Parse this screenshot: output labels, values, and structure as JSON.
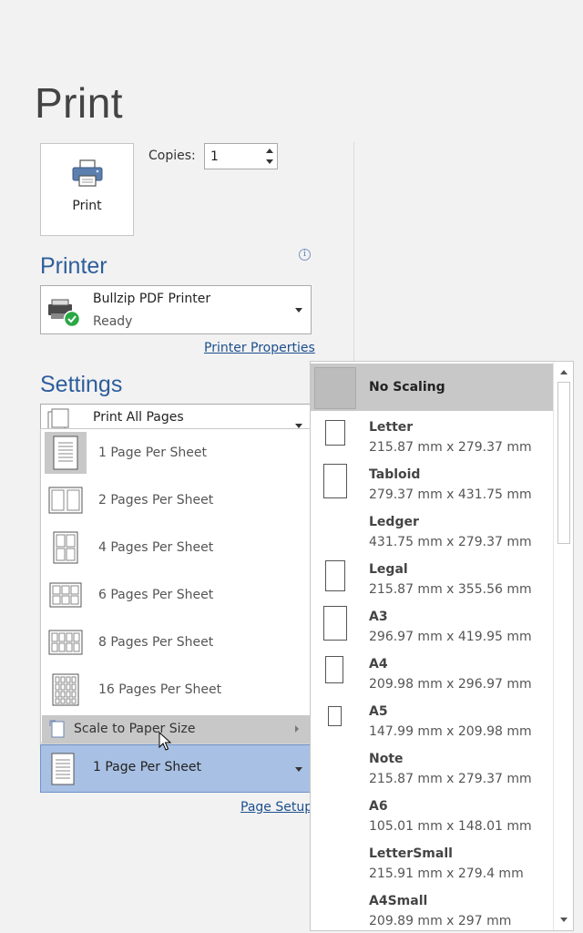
{
  "title": "Print",
  "print_button": {
    "label": "Print",
    "icon": "printer-icon"
  },
  "copies": {
    "label": "Copies:",
    "value": "1"
  },
  "printer": {
    "heading": "Printer",
    "name": "Bullzip PDF Printer",
    "status": "Ready",
    "properties_link": "Printer Properties"
  },
  "settings": {
    "heading": "Settings",
    "print_range": "Print All Pages",
    "pages_per_sheet_menu": [
      {
        "label": "1 Page Per Sheet",
        "selected": true
      },
      {
        "label": "2 Pages Per Sheet"
      },
      {
        "label": "4 Pages Per Sheet"
      },
      {
        "label": "6 Pages Per Sheet"
      },
      {
        "label": "8 Pages Per Sheet"
      },
      {
        "label": "16 Pages Per Sheet"
      }
    ],
    "scale_to_paper": "Scale to Paper Size",
    "pages_per_sheet_value": "1 Page Per Sheet",
    "page_setup_link": "Page Setup"
  },
  "paper_sizes": [
    {
      "name": "No Scaling",
      "dims": "",
      "selected": true
    },
    {
      "name": "Letter",
      "dims": "215.87 mm x 279.37 mm"
    },
    {
      "name": "Tabloid",
      "dims": "279.37 mm x 431.75 mm"
    },
    {
      "name": "Ledger",
      "dims": "431.75 mm x 279.37 mm"
    },
    {
      "name": "Legal",
      "dims": "215.87 mm x 355.56 mm"
    },
    {
      "name": "A3",
      "dims": "296.97 mm x 419.95 mm"
    },
    {
      "name": "A4",
      "dims": "209.98 mm x 296.97 mm"
    },
    {
      "name": "A5",
      "dims": "147.99 mm x 209.98 mm"
    },
    {
      "name": "Note",
      "dims": "215.87 mm x 279.37 mm"
    },
    {
      "name": "A6",
      "dims": "105.01 mm x 148.01 mm"
    },
    {
      "name": "LetterSmall",
      "dims": "215.91 mm x 279.4 mm"
    },
    {
      "name": "A4Small",
      "dims": "209.89 mm x 297 mm"
    }
  ],
  "colors": {
    "heading_blue": "#2e5e9c",
    "link_blue": "#1c4f8e",
    "selected_blue": "#a8c0e3",
    "ready_green": "#2aa844"
  }
}
